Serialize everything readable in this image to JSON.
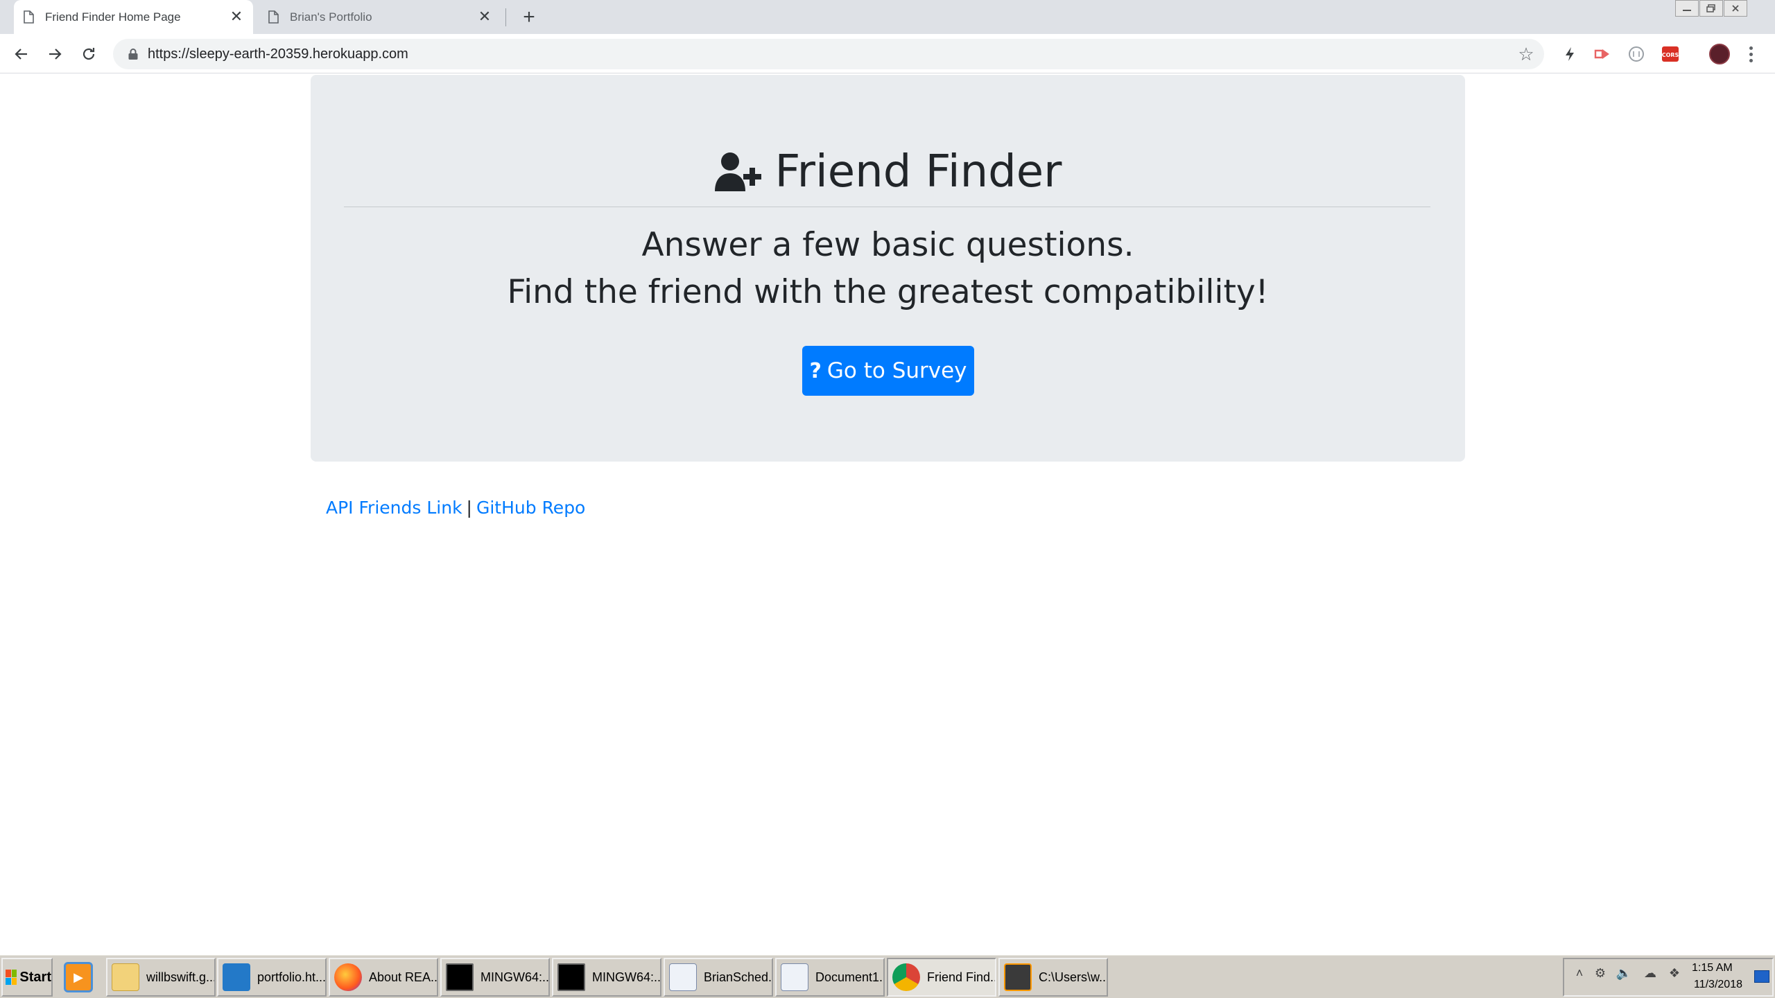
{
  "browser": {
    "tabs": [
      {
        "title": "Friend Finder Home Page",
        "close": "✕",
        "active": true
      },
      {
        "title": "Brian's Portfolio",
        "close": "✕",
        "active": false
      }
    ],
    "new_tab": "+",
    "url_scheme": "https://",
    "url_host": "sleepy-earth-20359.herokuapp.com",
    "extensions": [
      "bolt-icon",
      "arrow-extension-icon",
      "circle-extension-icon",
      "cors-icon"
    ],
    "cors_label": "CORS"
  },
  "page": {
    "title": "Friend Finder",
    "lead_line1": "Answer a few basic questions.",
    "lead_line2": "Find the friend with the greatest compatibility!",
    "survey_button": "Go to Survey",
    "survey_icon": "?",
    "footer": {
      "api_link": "API Friends Link",
      "separator": "|",
      "github_link": "GitHub Repo"
    },
    "colors": {
      "primary": "#007bff",
      "jumbotron": "#e9ecef",
      "text": "#212529"
    }
  },
  "taskbar": {
    "start": "Start",
    "tasks": [
      {
        "label": "willbswift.g...",
        "icon": "folder-icon"
      },
      {
        "label": "portfolio.ht...",
        "icon": "vscode-icon"
      },
      {
        "label": "About REA...",
        "icon": "firefox-icon"
      },
      {
        "label": "MINGW64:...",
        "icon": "terminal-icon"
      },
      {
        "label": "MINGW64:...",
        "icon": "terminal-icon"
      },
      {
        "label": "BrianSched...",
        "icon": "word-doc-icon"
      },
      {
        "label": "Document1...",
        "icon": "word-doc-icon"
      },
      {
        "label": "Friend Find...",
        "icon": "chrome-icon"
      },
      {
        "label": "C:\\Users\\w...",
        "icon": "sublime-icon"
      }
    ],
    "clock_time": "1:15 AM",
    "clock_date": "11/3/2018"
  }
}
